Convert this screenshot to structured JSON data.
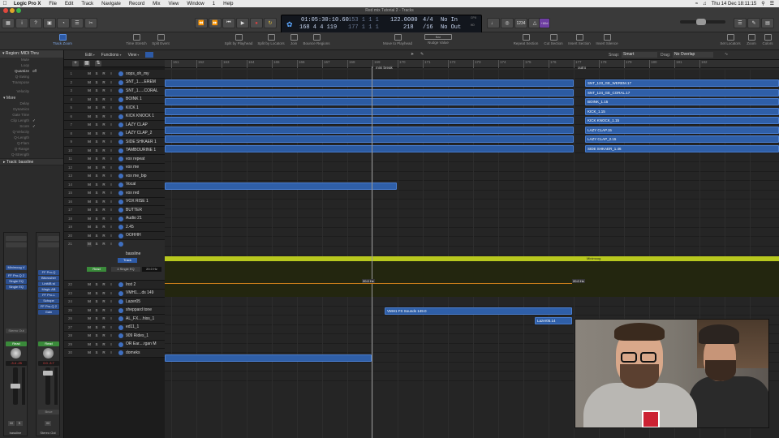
{
  "menubar": {
    "app": "Logic Pro X",
    "items": [
      "File",
      "Edit",
      "Track",
      "Navigate",
      "Record",
      "Mix",
      "View",
      "Window",
      "1",
      "Help"
    ],
    "clock": "Thu 14 Dec 18:11:15"
  },
  "window_title": "Red mix Tutorial 2 - Tracks",
  "lcd": {
    "time": "01:05:30:10.60",
    "bars": "168  4  4  119",
    "sub1": "153  1  1  1",
    "sub2": "177  1  1  1",
    "tempo": "122.0000",
    "tempo_sub": "218",
    "sig": "4/4",
    "sig_sub": "/16",
    "in": "No In",
    "out": "No Out",
    "cpu": "CPU",
    "hd": "HD",
    "counter": "1234",
    "counter_badge": "+60d"
  },
  "toolbar": [
    "Track Zoom",
    "Time Stretch",
    "Split Event",
    "Split by Playhead",
    "Split by Locators",
    "Join",
    "Bounce Regions",
    "Move to Playhead",
    "Nudge Value",
    "Repeat Section",
    "Cut Section",
    "Insert Section",
    "Insert Silence",
    "Set Locators",
    "Zoom",
    "Colors"
  ],
  "nudge": "Bar",
  "inspector": {
    "region": "Region: MIDI Thru",
    "rows": [
      {
        "label": "Mute",
        "value": ""
      },
      {
        "label": "Loop",
        "value": ""
      },
      {
        "label": "Quantize",
        "value": "off"
      },
      {
        "label": "Q-Swing",
        "value": ""
      },
      {
        "label": "Transpose",
        "value": ""
      },
      {
        "label": "Velocity",
        "value": ""
      }
    ],
    "more": "More",
    "more_rows": [
      {
        "label": "Delay",
        "value": ""
      },
      {
        "label": "Dynamics",
        "value": ""
      },
      {
        "label": "Gate Time",
        "value": ""
      },
      {
        "label": "Clip Length",
        "value": "✓"
      },
      {
        "label": "Score",
        "value": "✓"
      },
      {
        "label": "Q-Velocity",
        "value": ""
      },
      {
        "label": "Q-Length",
        "value": ""
      },
      {
        "label": "Q-Flam",
        "value": ""
      },
      {
        "label": "Q-Range",
        "value": ""
      },
      {
        "label": "Q-Strength",
        "value": ""
      }
    ],
    "track": "Track:  bassline"
  },
  "strip1": {
    "instrument": "Minimoog V",
    "plugins": [
      "FF Pro-Q 2",
      "Single EQ",
      "Single EQ"
    ],
    "io": "Stereo Out",
    "mode": "Read",
    "vol_l": "-3.4",
    "vol_r": "-25",
    "name": "bassline"
  },
  "strip2": {
    "plugins": [
      "FF Pro-Q",
      "Bitcrusher",
      "LinMB st",
      "Magic AB",
      "FF Pro-L",
      "Schope",
      "FF Pro-Q 2",
      "Gain"
    ],
    "mode": "Read",
    "vol_l": "0.0",
    "vol_r": "-3.7",
    "name": "Stereo Out",
    "btn": "Bnce"
  },
  "tracks_menu": [
    "Edit",
    "Functions",
    "View"
  ],
  "arrange_bar": {
    "snap_label": "Snap:",
    "snap": "Smart",
    "drag_label": "Drag:",
    "drag": "No Overlap"
  },
  "ruler": [
    "161",
    "162",
    "163",
    "164",
    "165",
    "166",
    "167",
    "168",
    "169",
    "170",
    "171",
    "172",
    "173",
    "174",
    "175",
    "176",
    "177",
    "178",
    "179",
    "180",
    "181",
    "182"
  ],
  "markers": [
    "mini break",
    "outro"
  ],
  "tracks": [
    {
      "n": "1",
      "name": "oops_oh_my"
    },
    {
      "n": "2",
      "name": "SNT_1.....EREM"
    },
    {
      "n": "3",
      "name": "SNT_1.....CORAL"
    },
    {
      "n": "4",
      "name": "BOINK 1"
    },
    {
      "n": "5",
      "name": "KICK 1"
    },
    {
      "n": "6",
      "name": "KICK KNOCK 1"
    },
    {
      "n": "7",
      "name": "LAZY CLAP"
    },
    {
      "n": "8",
      "name": "LAZY CLAP_2"
    },
    {
      "n": "9",
      "name": "SIDE SHKAER 1"
    },
    {
      "n": "10",
      "name": "TAMBOURINE 1"
    },
    {
      "n": "11",
      "name": "vox repeat"
    },
    {
      "n": "12",
      "name": "vox me"
    },
    {
      "n": "13",
      "name": "vox me_bip"
    },
    {
      "n": "14",
      "name": "Vocal"
    },
    {
      "n": "15",
      "name": "vox red"
    },
    {
      "n": "16",
      "name": "VOX RISE 1"
    },
    {
      "n": "17",
      "name": "BUTTER"
    },
    {
      "n": "18",
      "name": "Audio 21"
    },
    {
      "n": "19",
      "name": "2.45"
    },
    {
      "n": "20",
      "name": "OOHHH"
    },
    {
      "n": "21",
      "name": "bassline",
      "big": true,
      "mode": "Read",
      "track_btn": "Track",
      "plugin": "4 Single EQ",
      "freq": "20.0 Hz"
    },
    {
      "n": "22",
      "name": "Inst 2"
    },
    {
      "n": "23",
      "name": "VMH1....ds 149"
    },
    {
      "n": "24",
      "name": "Lazer05"
    },
    {
      "n": "25",
      "name": "sheppard tone"
    },
    {
      "n": "26",
      "name": "AL_FX....hiss_1"
    },
    {
      "n": "27",
      "name": "ed11_1"
    },
    {
      "n": "28",
      "name": "909 Rides_1"
    },
    {
      "n": "29",
      "name": "OR Ear....rgan M"
    },
    {
      "n": "30",
      "name": "domeks"
    }
  ],
  "region_labels": [
    "SNT_123_GE_WEREM.17",
    "SNT_124_GE_CORAL.17",
    "BOINK_1.15",
    "KICK_1.15",
    "KICK KNOCK_1.15",
    "LAZY CLAP.15",
    "LAZY CLAP_2.15",
    "SIDE SHKAER_1.46"
  ],
  "green_region": "Minimoog",
  "automation_labels": [
    "20.0 Hz",
    "20.0 Hz"
  ],
  "regions_other": [
    "VMH1 FX Sounds 149.0",
    "Lazer05.14"
  ],
  "colors": {
    "region": "#2f5fa8",
    "green": "#b8c81e",
    "automation": "#c77c1a"
  }
}
